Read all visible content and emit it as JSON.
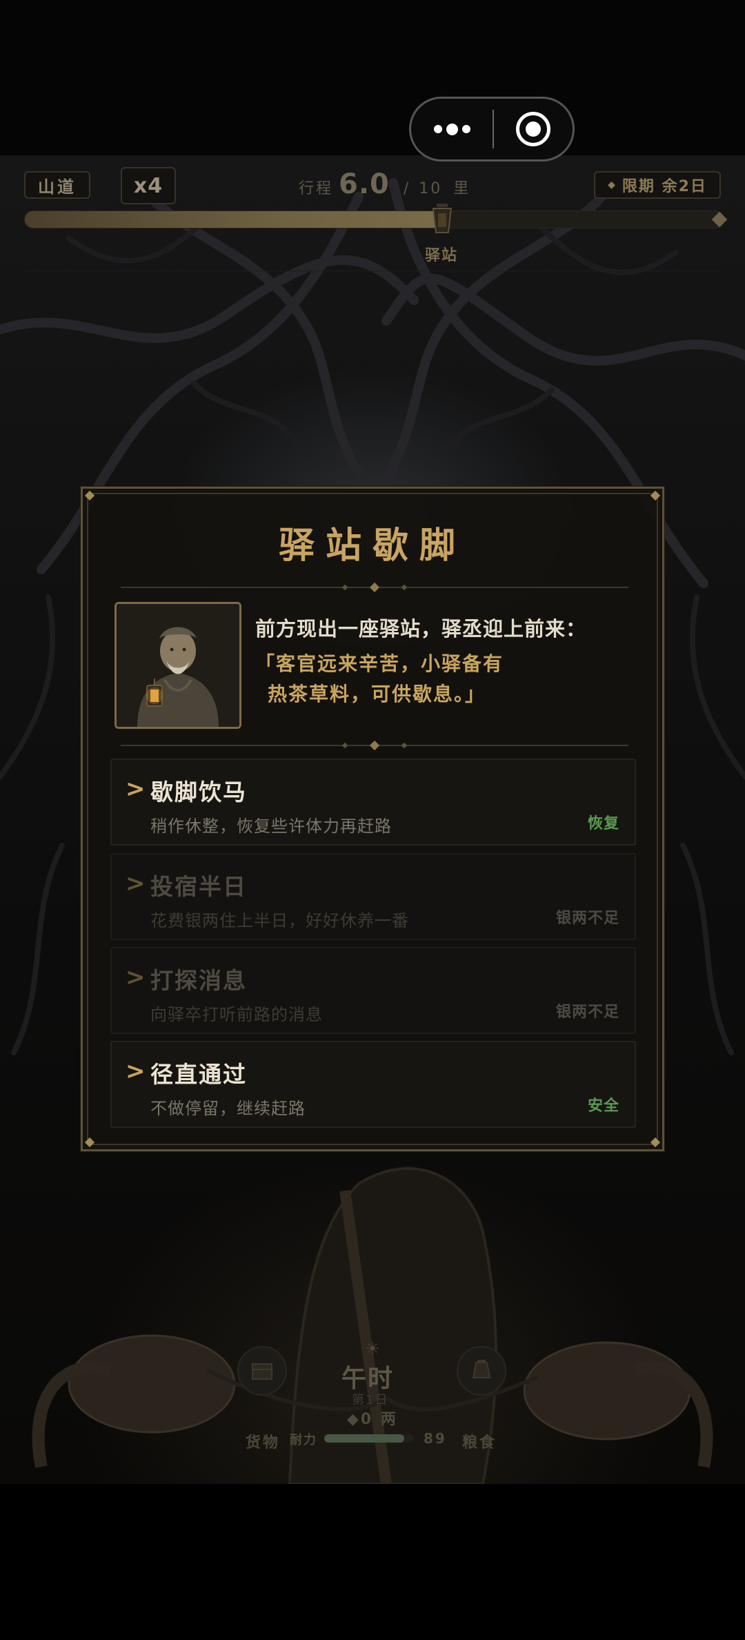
{
  "top_hud": {
    "route": "山道",
    "speed": "x4",
    "progress_label": "行程",
    "progress_current": "6.0",
    "progress_sep": "/",
    "progress_total": "10",
    "progress_unit": "里",
    "progress_fraction": 0.6,
    "deadline": "限期 余2日",
    "station_marker": "驿站"
  },
  "dialog": {
    "title": "驿站歇脚",
    "intro": "前方现出一座驿站，驿丞迎上前来：",
    "quote_lines": [
      "「客官远来辛苦，小驿备有",
      "热茶草料，可供歇息。」"
    ],
    "options": [
      {
        "title": "歇脚饮马",
        "desc": "稍作休整，恢复些许体力再赶路",
        "tag": "恢复",
        "enabled": true
      },
      {
        "title": "投宿半日",
        "desc": "花费银两住上半日，好好休养一番",
        "tag": "银两不足",
        "enabled": false
      },
      {
        "title": "打探消息",
        "desc": "向驿卒打听前路的消息",
        "tag": "银两不足",
        "enabled": false
      },
      {
        "title": "径直通过",
        "desc": "不做停留，继续赶路",
        "tag": "安全",
        "enabled": true
      }
    ],
    "chevron": ">"
  },
  "bottom_hud": {
    "time": "午时",
    "day": "第1日",
    "silver": "◆0 两",
    "goods_label": "货物",
    "stamina_label": "耐力",
    "stamina_value": "89",
    "stamina_fraction": 0.89,
    "food_label": "粮食"
  },
  "colors": {
    "accent_gold": "#c9a462",
    "restore_green": "#5a9a52",
    "disabled_text": "#4e4a42"
  }
}
